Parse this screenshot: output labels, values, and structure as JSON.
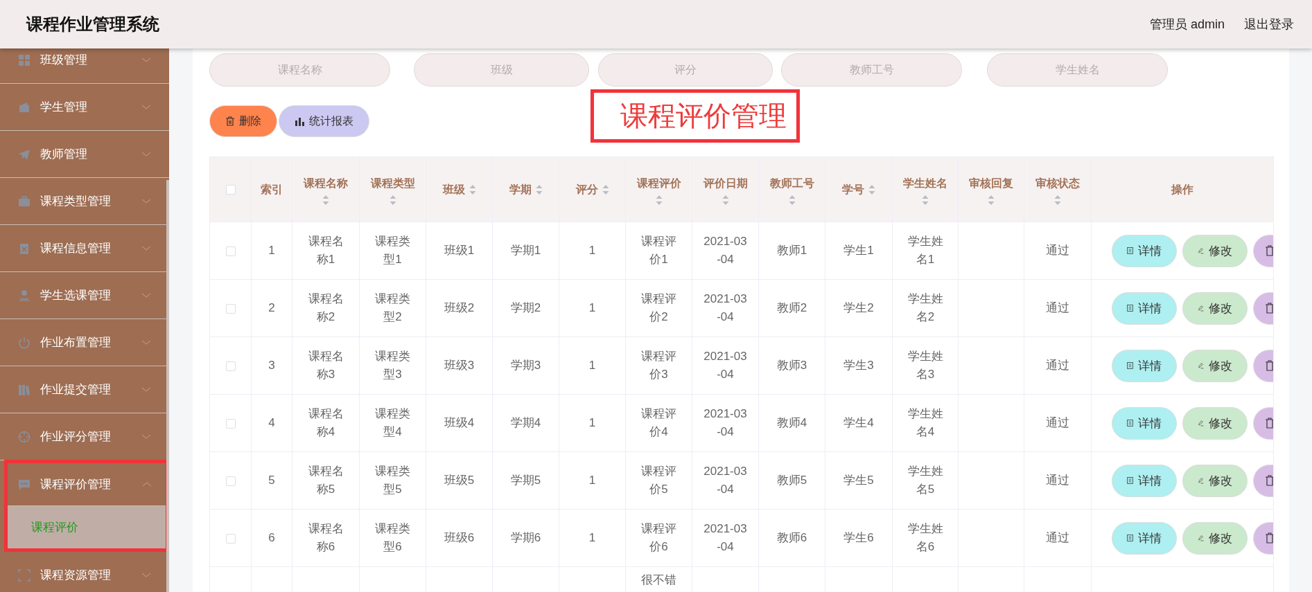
{
  "header": {
    "title": "课程作业管理系统",
    "user": "管理员 admin",
    "logout": "退出登录"
  },
  "sidebar": {
    "items": [
      {
        "label": "班级管理",
        "expanded": false
      },
      {
        "label": "学生管理",
        "expanded": false
      },
      {
        "label": "教师管理",
        "expanded": false
      },
      {
        "label": "课程类型管理",
        "expanded": false
      },
      {
        "label": "课程信息管理",
        "expanded": false
      },
      {
        "label": "学生选课管理",
        "expanded": false
      },
      {
        "label": "作业布置管理",
        "expanded": false
      },
      {
        "label": "作业提交管理",
        "expanded": false
      },
      {
        "label": "作业评分管理",
        "expanded": false
      },
      {
        "label": "课程评价管理",
        "expanded": true,
        "children": [
          {
            "label": "课程评价",
            "selected": true
          }
        ]
      },
      {
        "label": "课程资源管理",
        "expanded": false
      }
    ]
  },
  "search": {
    "fields": [
      {
        "placeholder": "课程名称"
      },
      {
        "placeholder": "班级"
      },
      {
        "placeholder": "评分"
      },
      {
        "placeholder": "教师工号"
      },
      {
        "placeholder": "学生姓名"
      }
    ]
  },
  "toolbar": {
    "buttons": [
      {
        "label": "删除",
        "kind": "delete"
      },
      {
        "label": "统计报表",
        "kind": "report"
      }
    ]
  },
  "page_title": "课程评价管理",
  "table": {
    "select_all_checked": false,
    "columns": [
      {
        "label": "索引",
        "sortable": false
      },
      {
        "label": "课程名称",
        "sortable": true
      },
      {
        "label": "课程类型",
        "sortable": true
      },
      {
        "label": "班级",
        "sortable": true
      },
      {
        "label": "学期",
        "sortable": true
      },
      {
        "label": "评分",
        "sortable": true
      },
      {
        "label": "课程评价",
        "sortable": true
      },
      {
        "label": "评价日期",
        "sortable": true
      },
      {
        "label": "教师工号",
        "sortable": true
      },
      {
        "label": "学号",
        "sortable": true
      },
      {
        "label": "学生姓名",
        "sortable": true
      },
      {
        "label": "审核回复",
        "sortable": true
      },
      {
        "label": "审核状态",
        "sortable": true
      },
      {
        "label": "操作",
        "sortable": false
      }
    ],
    "rows": [
      {
        "checked": false,
        "cells": [
          "1",
          "课程名称1",
          "课程类型1",
          "班级1",
          "学期1",
          "1",
          "课程评价1",
          "2021-03-04",
          "教师1",
          "学生1",
          "学生姓名1",
          "",
          "通过"
        ],
        "actions": [
          {
            "kind": "detail",
            "label": "详情"
          },
          {
            "kind": "edit",
            "label": "修改"
          },
          {
            "kind": "delete"
          }
        ]
      },
      {
        "checked": false,
        "cells": [
          "2",
          "课程名称2",
          "课程类型2",
          "班级2",
          "学期2",
          "1",
          "课程评价2",
          "2021-03-04",
          "教师2",
          "学生2",
          "学生姓名2",
          "",
          "通过"
        ],
        "actions": [
          {
            "kind": "detail",
            "label": "详情"
          },
          {
            "kind": "edit",
            "label": "修改"
          },
          {
            "kind": "delete"
          }
        ]
      },
      {
        "checked": false,
        "cells": [
          "3",
          "课程名称3",
          "课程类型3",
          "班级3",
          "学期3",
          "1",
          "课程评价3",
          "2021-03-04",
          "教师3",
          "学生3",
          "学生姓名3",
          "",
          "通过"
        ],
        "actions": [
          {
            "kind": "detail",
            "label": "详情"
          },
          {
            "kind": "edit",
            "label": "修改"
          },
          {
            "kind": "delete"
          }
        ]
      },
      {
        "checked": false,
        "cells": [
          "4",
          "课程名称4",
          "课程类型4",
          "班级4",
          "学期4",
          "1",
          "课程评价4",
          "2021-03-04",
          "教师4",
          "学生4",
          "学生姓名4",
          "",
          "通过"
        ],
        "actions": [
          {
            "kind": "detail",
            "label": "详情"
          },
          {
            "kind": "edit",
            "label": "修改"
          },
          {
            "kind": "delete"
          }
        ]
      },
      {
        "checked": false,
        "cells": [
          "5",
          "课程名称5",
          "课程类型5",
          "班级5",
          "学期5",
          "1",
          "课程评价5",
          "2021-03-04",
          "教师5",
          "学生5",
          "学生姓名5",
          "",
          "通过"
        ],
        "actions": [
          {
            "kind": "detail",
            "label": "详情"
          },
          {
            "kind": "edit",
            "label": "修改"
          },
          {
            "kind": "delete"
          }
        ]
      },
      {
        "checked": false,
        "cells": [
          "6",
          "课程名称6",
          "课程类型6",
          "班级6",
          "学期6",
          "1",
          "课程评价6",
          "2021-03-04",
          "教师6",
          "学生6",
          "学生姓名6",
          "",
          "通过"
        ],
        "actions": [
          {
            "kind": "detail",
            "label": "详情"
          },
          {
            "kind": "edit",
            "label": "修改"
          },
          {
            "kind": "delete"
          }
        ]
      }
    ],
    "partial_row": {
      "course_evaluation": "很不错"
    }
  }
}
